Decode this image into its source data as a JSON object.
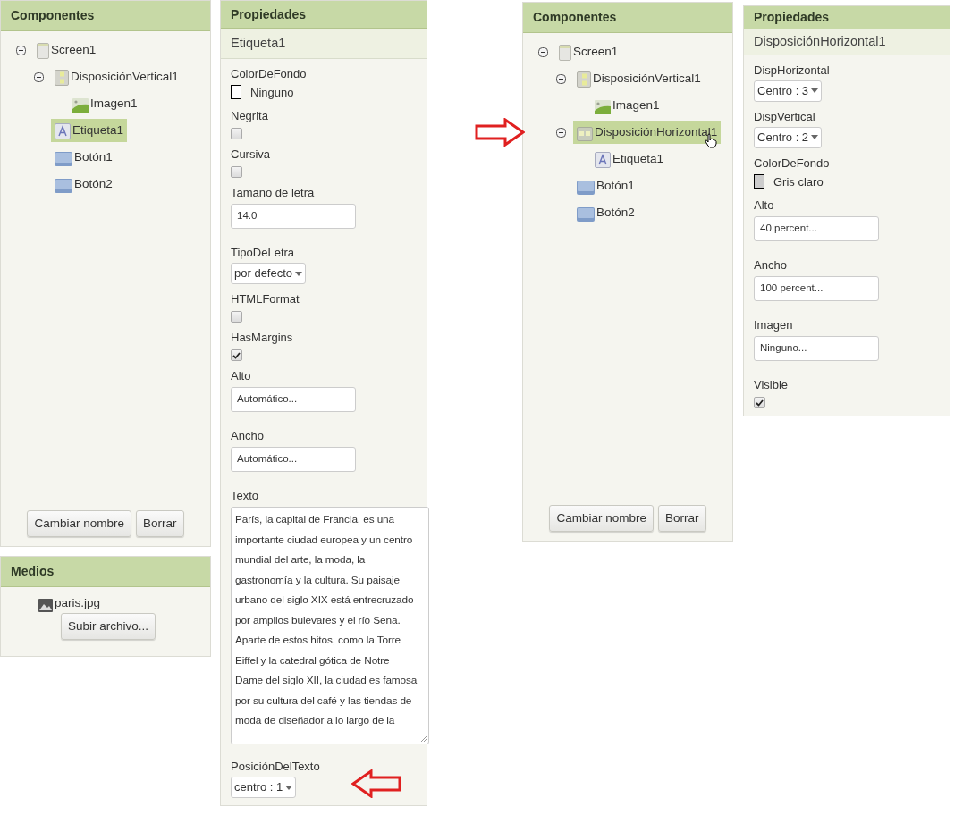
{
  "screens": [
    {
      "components": {
        "title": "Componentes",
        "tree": [
          {
            "label": "Screen1",
            "kind": "screen",
            "expanded": true,
            "selected": false,
            "children": [
              {
                "label": "DisposiciónVertical1",
                "kind": "vertical",
                "expanded": true,
                "selected": false,
                "children": [
                  {
                    "label": "Imagen1",
                    "kind": "image",
                    "selected": false
                  }
                ]
              },
              {
                "label": "Etiqueta1",
                "kind": "label",
                "selected": true
              },
              {
                "label": "Botón1",
                "kind": "button",
                "selected": false
              },
              {
                "label": "Botón2",
                "kind": "button",
                "selected": false
              }
            ]
          }
        ],
        "buttons": [
          "Cambiar nombre",
          "Borrar"
        ]
      },
      "media": {
        "title": "Medios",
        "files": [
          "paris.jpg"
        ],
        "upload": "Subir archivo..."
      },
      "properties": {
        "title": "Propiedades",
        "component": "Etiqueta1",
        "items": [
          {
            "kind": "color",
            "label": "ColorDeFondo",
            "value": "Ninguno",
            "color": "#ffffff"
          },
          {
            "kind": "checkbox",
            "label": "Negrita",
            "checked": false
          },
          {
            "kind": "checkbox",
            "label": "Cursiva",
            "checked": false
          },
          {
            "kind": "field",
            "label": "Tamaño de letra",
            "value": "14.0"
          },
          {
            "kind": "select",
            "label": "TipoDeLetra",
            "value": "por defecto"
          },
          {
            "kind": "checkbox",
            "label": "HTMLFormat",
            "checked": false
          },
          {
            "kind": "checkbox",
            "label": "HasMargins",
            "checked": true
          },
          {
            "kind": "field",
            "label": "Alto",
            "value": "Automático..."
          },
          {
            "kind": "field",
            "label": "Ancho",
            "value": "Automático..."
          },
          {
            "kind": "textarea",
            "label": "Texto",
            "value": "París, la capital de Francia, es una importante ciudad europea y un centro mundial del arte, la moda, la gastronomía y la cultura. Su paisaje urbano del siglo XIX está entrecruzado por amplios bulevares y el río Sena. Aparte de estos hitos, como la Torre Eiffel y la catedral gótica de Notre Dame del siglo XII, la ciudad es famosa por su cultura del café y las tiendas de moda de diseñador a lo largo de la"
          },
          {
            "kind": "select",
            "label": "PosiciónDelTexto",
            "value": "centro : 1",
            "arrow": true
          }
        ]
      }
    },
    {
      "components": {
        "title": "Componentes",
        "tree": [
          {
            "label": "Screen1",
            "kind": "screen",
            "expanded": true,
            "selected": false,
            "children": [
              {
                "label": "DisposiciónVertical1",
                "kind": "vertical",
                "expanded": true,
                "selected": false,
                "children": [
                  {
                    "label": "Imagen1",
                    "kind": "image",
                    "selected": false
                  }
                ]
              },
              {
                "label": "DisposiciónHorizontal1",
                "kind": "horizontal",
                "expanded": true,
                "selected": true,
                "pointer": true,
                "arrow": true,
                "children": [
                  {
                    "label": "Etiqueta1",
                    "kind": "label",
                    "selected": false
                  }
                ]
              },
              {
                "label": "Botón1",
                "kind": "button",
                "selected": false
              },
              {
                "label": "Botón2",
                "kind": "button",
                "selected": false
              }
            ]
          }
        ],
        "buttons": [
          "Cambiar nombre",
          "Borrar"
        ]
      },
      "properties": {
        "title": "Propiedades",
        "component": "DisposiciónHorizontal1",
        "items": [
          {
            "kind": "select",
            "label": "DispHorizontal",
            "value": "Centro : 3"
          },
          {
            "kind": "select",
            "label": "DispVertical",
            "value": "Centro : 2"
          },
          {
            "kind": "color",
            "label": "ColorDeFondo",
            "value": "Gris claro",
            "color": "#cccccc"
          },
          {
            "kind": "field",
            "label": "Alto",
            "value": "40 percent..."
          },
          {
            "kind": "field",
            "label": "Ancho",
            "value": "100 percent..."
          },
          {
            "kind": "field",
            "label": "Imagen",
            "value": "Ninguno..."
          },
          {
            "kind": "checkbox",
            "label": "Visible",
            "checked": true
          }
        ]
      }
    }
  ]
}
